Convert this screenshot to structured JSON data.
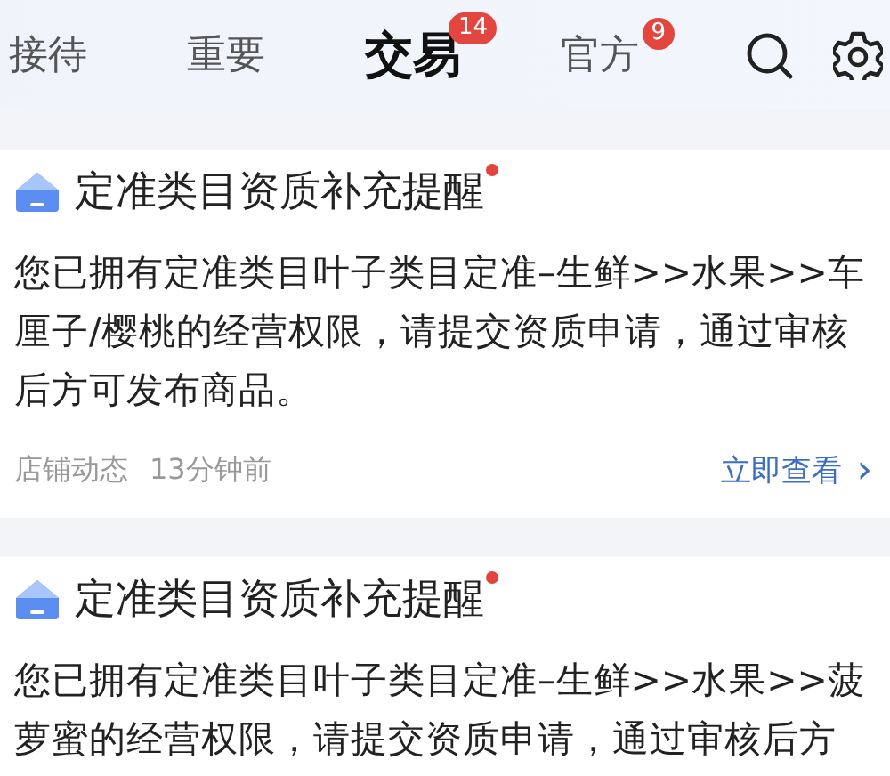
{
  "tabs": [
    {
      "label": "接待",
      "selected": false
    },
    {
      "label": "重要",
      "selected": false
    },
    {
      "label": "交易",
      "selected": true,
      "badge": "14"
    },
    {
      "label": "官方",
      "selected": false,
      "badge": "9"
    }
  ],
  "notices": [
    {
      "title": "定准类目资质补充提醒",
      "unread": true,
      "body": "您已拥有定准类目叶子类目定准–生鲜>>水果>>车厘子/樱桃的经营权限，请提交资质申请，通过审核后方可发布商品。",
      "source": "店铺动态",
      "time": "13分钟前",
      "action": "立即查看",
      "chevron": "›"
    },
    {
      "title": "定准类目资质补充提醒",
      "unread": true,
      "body": "您已拥有定准类目叶子类目定准–生鲜>>水果>>菠萝蜜的经营权限，请提交资质申请，通过审核后方"
    }
  ]
}
